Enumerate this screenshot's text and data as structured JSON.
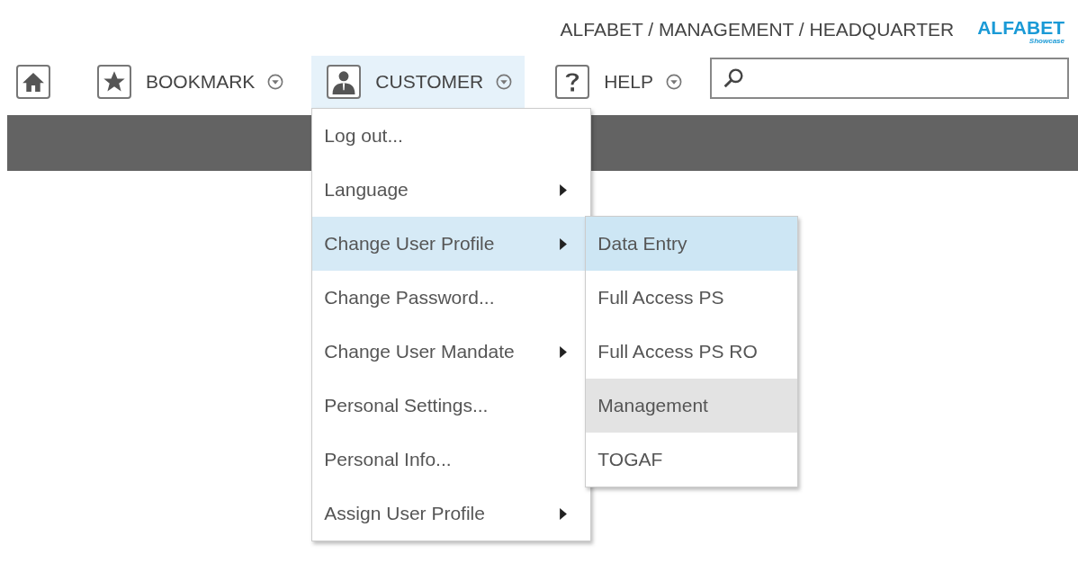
{
  "breadcrumb": "ALFABET / MANAGEMENT / HEADQUARTER",
  "logo": {
    "name": "ALFABET",
    "tagline": "Showcase"
  },
  "nav": [
    {
      "kind": "home",
      "selected": false,
      "has_dropdown": false
    },
    {
      "kind": "bookmark",
      "label": "BOOKMARK",
      "selected": false,
      "has_dropdown": true
    },
    {
      "kind": "customer",
      "label": "CUSTOMER",
      "selected": true,
      "has_dropdown": true
    },
    {
      "kind": "help",
      "label": "HELP",
      "selected": false,
      "has_dropdown": true
    }
  ],
  "menu": [
    {
      "label": "Log out...",
      "selected": false,
      "submenu": false
    },
    {
      "label": "Language",
      "selected": false,
      "submenu": true
    },
    {
      "label": "Change User Profile",
      "selected": true,
      "submenu": true
    },
    {
      "label": "Change Password...",
      "selected": false,
      "submenu": false
    },
    {
      "label": "Change User Mandate",
      "selected": false,
      "submenu": true
    },
    {
      "label": "Personal Settings...",
      "selected": false,
      "submenu": false
    },
    {
      "label": "Personal Info...",
      "selected": false,
      "submenu": false
    },
    {
      "label": "Assign User Profile",
      "selected": false,
      "submenu": true
    }
  ],
  "submenu": [
    {
      "label": "Data Entry",
      "selected": true,
      "current": false
    },
    {
      "label": "Full Access PS",
      "selected": false,
      "current": false
    },
    {
      "label": "Full Access PS RO",
      "selected": false,
      "current": false
    },
    {
      "label": "Management",
      "selected": false,
      "current": true
    },
    {
      "label": "TOGAF",
      "selected": false,
      "current": false
    }
  ]
}
